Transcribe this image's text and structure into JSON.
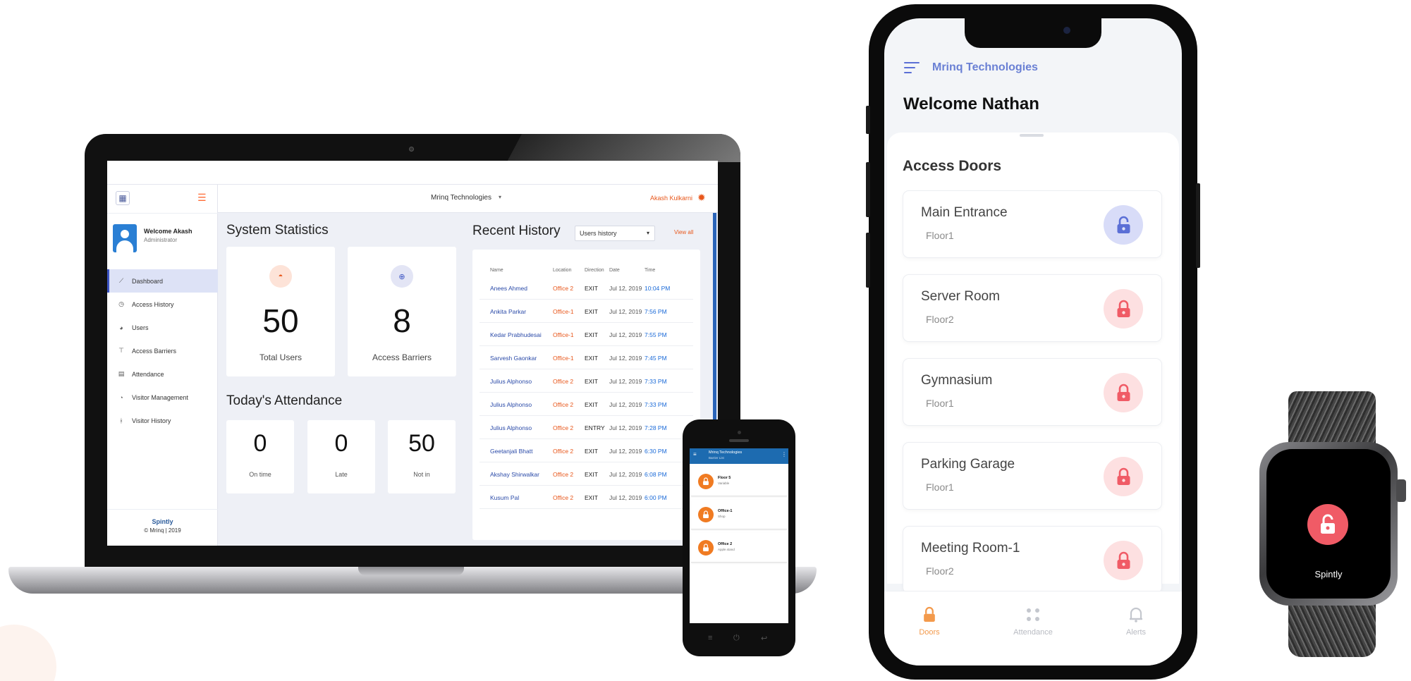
{
  "dashboard": {
    "company": "Mrinq Technologies",
    "user_name": "Akash Kulkarni",
    "welcome": "Welcome Akash",
    "role": "Administrator",
    "sidebar_items": [
      {
        "label": "Dashboard",
        "icon": "trend-icon",
        "glyph": "⟋"
      },
      {
        "label": "Access History",
        "icon": "history-icon",
        "glyph": "◷"
      },
      {
        "label": "Users",
        "icon": "users-icon",
        "glyph": "◕"
      },
      {
        "label": "Access Barriers",
        "icon": "barrier-icon",
        "glyph": "⊤"
      },
      {
        "label": "Attendance",
        "icon": "attendance-icon",
        "glyph": "▤"
      },
      {
        "label": "Visitor Management",
        "icon": "visitor-icon",
        "glyph": "◔"
      },
      {
        "label": "Visitor History",
        "icon": "walking-icon",
        "glyph": "ᚼ"
      }
    ],
    "brand": "Spintly",
    "copyright": "© Mrinq | 2019",
    "system_statistics": {
      "title": "System Statistics",
      "total_users": {
        "value": "50",
        "label": "Total Users"
      },
      "access_barriers": {
        "value": "8",
        "label": "Access Barriers"
      }
    },
    "attendance": {
      "title": "Today's Attendance",
      "on_time": {
        "value": "0",
        "label": "On time"
      },
      "late": {
        "value": "0",
        "label": "Late"
      },
      "not_in": {
        "value": "50",
        "label": "Not in"
      }
    },
    "recent_history": {
      "title": "Recent History",
      "filter": "Users history",
      "view_all": "View all",
      "columns": [
        "Name",
        "Location",
        "Direction",
        "Date",
        "Time"
      ],
      "rows": [
        {
          "name": "Anees Ahmed",
          "location": "Office 2",
          "direction": "EXIT",
          "date": "Jul 12, 2019",
          "time": "10:04 PM"
        },
        {
          "name": "Ankita Parkar",
          "location": "Office-1",
          "direction": "EXIT",
          "date": "Jul 12, 2019",
          "time": "7:56 PM"
        },
        {
          "name": "Kedar Prabhudesai",
          "location": "Office-1",
          "direction": "EXIT",
          "date": "Jul 12, 2019",
          "time": "7:55 PM"
        },
        {
          "name": "Sarvesh Gaonkar",
          "location": "Office-1",
          "direction": "EXIT",
          "date": "Jul 12, 2019",
          "time": "7:45 PM"
        },
        {
          "name": "Julius Alphonso",
          "location": "Office 2",
          "direction": "EXIT",
          "date": "Jul 12, 2019",
          "time": "7:33 PM"
        },
        {
          "name": "Julius Alphonso",
          "location": "Office 2",
          "direction": "EXIT",
          "date": "Jul 12, 2019",
          "time": "7:33 PM"
        },
        {
          "name": "Julius Alphonso",
          "location": "Office 2",
          "direction": "ENTRY",
          "date": "Jul 12, 2019",
          "time": "7:28 PM"
        },
        {
          "name": "Geetanjali Bhatt",
          "location": "Office 2",
          "direction": "EXIT",
          "date": "Jul 12, 2019",
          "time": "6:30 PM"
        },
        {
          "name": "Akshay Shirwalkar",
          "location": "Office 2",
          "direction": "EXIT",
          "date": "Jul 12, 2019",
          "time": "6:08 PM"
        },
        {
          "name": "Kusum Pal",
          "location": "Office 2",
          "direction": "EXIT",
          "date": "Jul 12, 2019",
          "time": "6:00 PM"
        }
      ]
    }
  },
  "small_phone": {
    "title": "Mrinq Technologies",
    "subtitle": "Barrier List",
    "items": [
      {
        "name": "Floor 5",
        "floor": "Variable"
      },
      {
        "name": "Office-1",
        "floor": "Shop"
      },
      {
        "name": "Office 2",
        "floor": "Apple.stand"
      }
    ]
  },
  "phone": {
    "company": "Mrinq Technologies",
    "welcome": "Welcome Nathan",
    "section_title": "Access Doors",
    "doors": [
      {
        "name": "Main Entrance",
        "floor": "Floor1",
        "state": "unlocked"
      },
      {
        "name": "Server Room",
        "floor": "Floor2",
        "state": "locked"
      },
      {
        "name": "Gymnasium",
        "floor": "Floor1",
        "state": "locked"
      },
      {
        "name": "Parking Garage",
        "floor": "Floor1",
        "state": "locked"
      },
      {
        "name": "Meeting Room-1",
        "floor": "Floor2",
        "state": "locked"
      }
    ],
    "tabs": [
      {
        "label": "Doors",
        "icon": "lock-icon",
        "active": true
      },
      {
        "label": "Attendance",
        "icon": "grid-icon",
        "active": false
      },
      {
        "label": "Alerts",
        "icon": "bell-icon",
        "active": false
      }
    ]
  },
  "watch": {
    "brand": "Spintly"
  },
  "colors": {
    "accent_orange": "#ff6b35",
    "primary_blue": "#2a64b8",
    "lock_red": "#f05b66",
    "lock_blue": "#5b6fd6"
  }
}
